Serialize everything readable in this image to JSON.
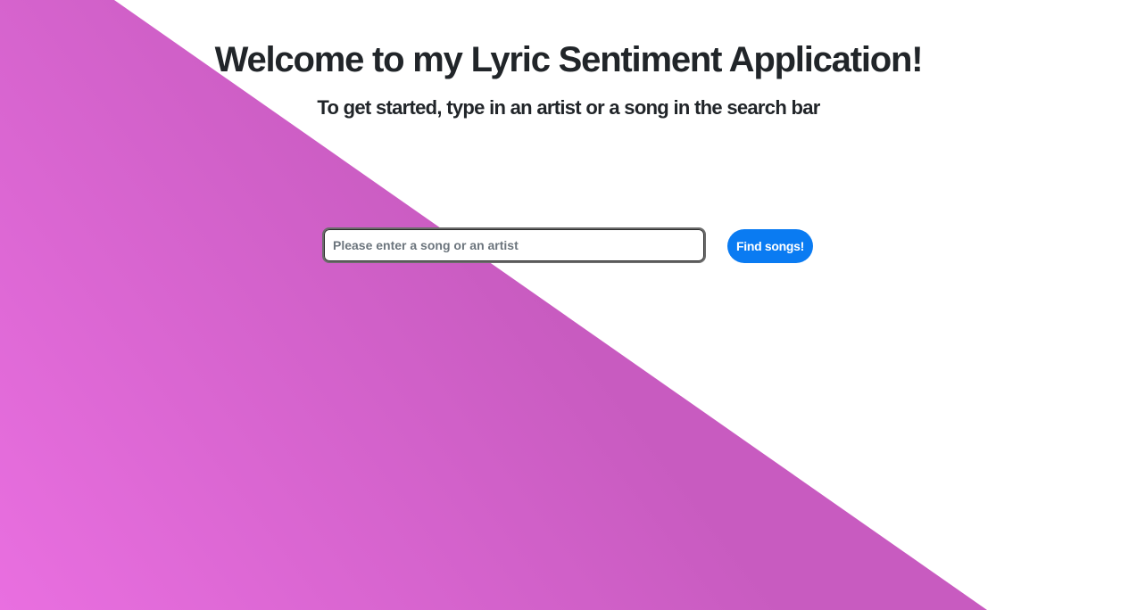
{
  "header": {
    "title": "Welcome to my Lyric Sentiment Application!",
    "subtitle": "To get started, type in an artist or a song in the search bar"
  },
  "search": {
    "placeholder": "Please enter a song or an artist",
    "value": "",
    "button_label": "Find songs!"
  },
  "colors": {
    "gradient_start": "#e96fe0",
    "gradient_end": "#c85bc0",
    "button": "#0a7bf2",
    "text": "#212529"
  }
}
